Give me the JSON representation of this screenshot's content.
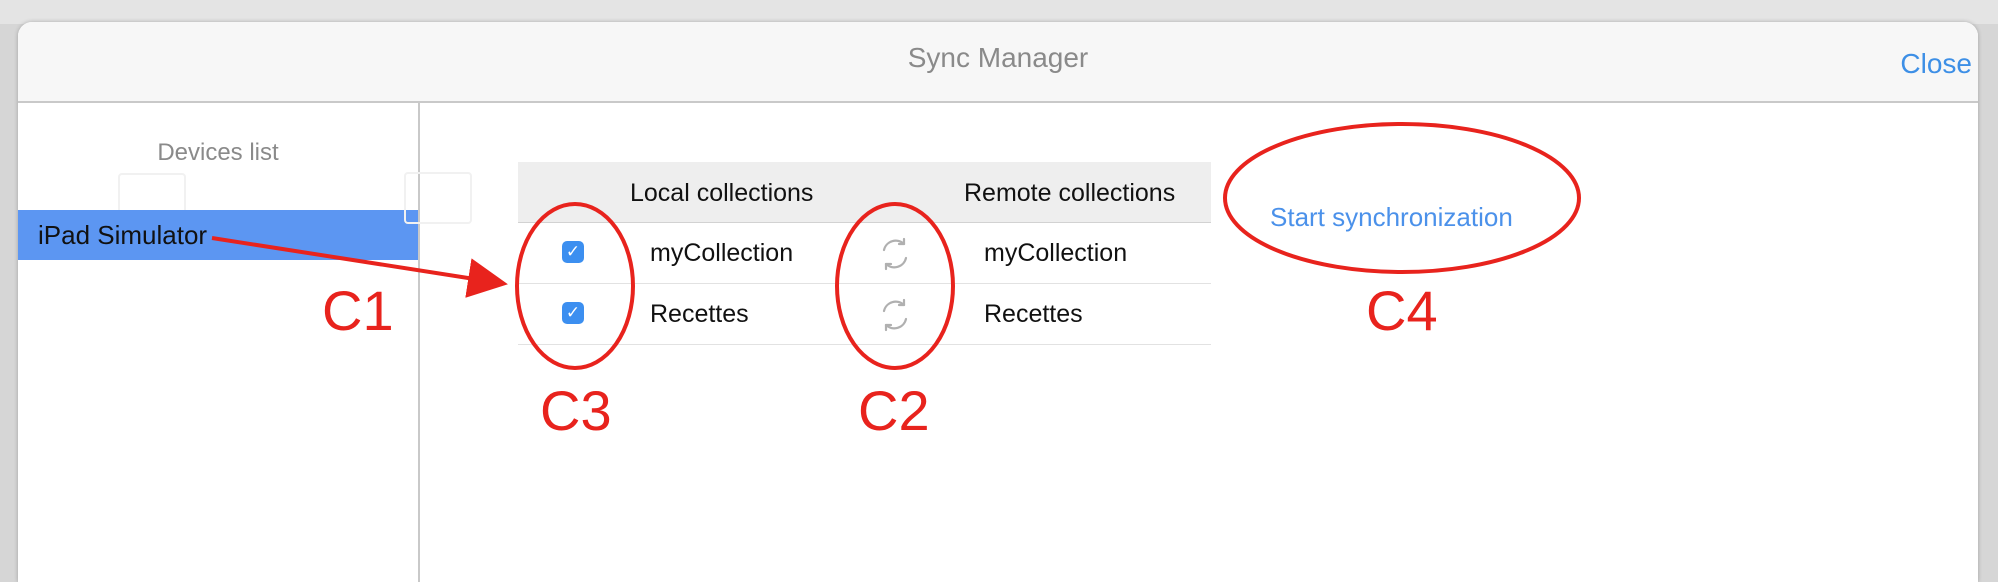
{
  "window": {
    "title": "Sync Manager",
    "close_label": "Close"
  },
  "sidebar": {
    "title": "Devices list",
    "items": [
      {
        "label": "iPad Simulator",
        "selected": true
      }
    ]
  },
  "table": {
    "headers": {
      "local": "Local collections",
      "remote": "Remote collections"
    },
    "rows": [
      {
        "local": "myCollection",
        "remote": "myCollection",
        "checked": true,
        "sync_icon": "sync-arrows-icon"
      },
      {
        "local": "Recettes",
        "remote": "Recettes",
        "checked": true,
        "sync_icon": "sync-arrows-icon"
      }
    ]
  },
  "actions": {
    "start_sync_label": "Start synchronization"
  },
  "annotations": {
    "c1": "C1",
    "c2": "C2",
    "c3": "C3",
    "c4": "C4",
    "color": "#e8231d"
  },
  "colors": {
    "accent": "#3d8fe6",
    "selection": "#5c96f2",
    "checkbox": "#3c8ff0"
  }
}
